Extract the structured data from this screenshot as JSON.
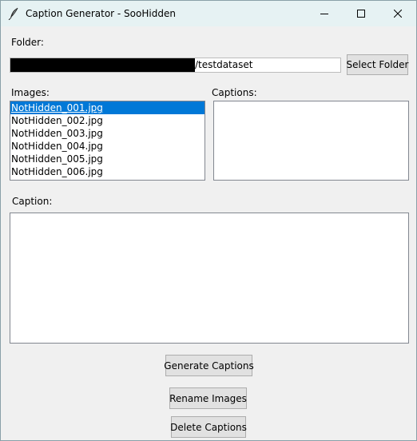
{
  "window": {
    "title": "Caption Generator - SooHidden"
  },
  "folder": {
    "label": "Folder:",
    "path_visible": "/testdataset",
    "select_button": "Select Folder"
  },
  "images": {
    "label": "Images:",
    "items": [
      "NotHidden_001.jpg",
      "NotHidden_002.jpg",
      "NotHidden_003.jpg",
      "NotHidden_004.jpg",
      "NotHidden_005.jpg",
      "NotHidden_006.jpg"
    ],
    "selected_index": 0
  },
  "captions": {
    "label": "Captions:"
  },
  "caption": {
    "label": "Caption:",
    "value": ""
  },
  "actions": {
    "generate": "Generate Captions",
    "rename": "Rename Images",
    "delete": "Delete Captions"
  },
  "icons": {
    "app": "feather-icon",
    "minimize": "minimize-icon",
    "maximize": "maximize-icon",
    "close": "close-icon"
  },
  "colors": {
    "titlebar": "#e6f2f3",
    "selection": "#0078d7",
    "window_bg": "#f0f0f0"
  }
}
